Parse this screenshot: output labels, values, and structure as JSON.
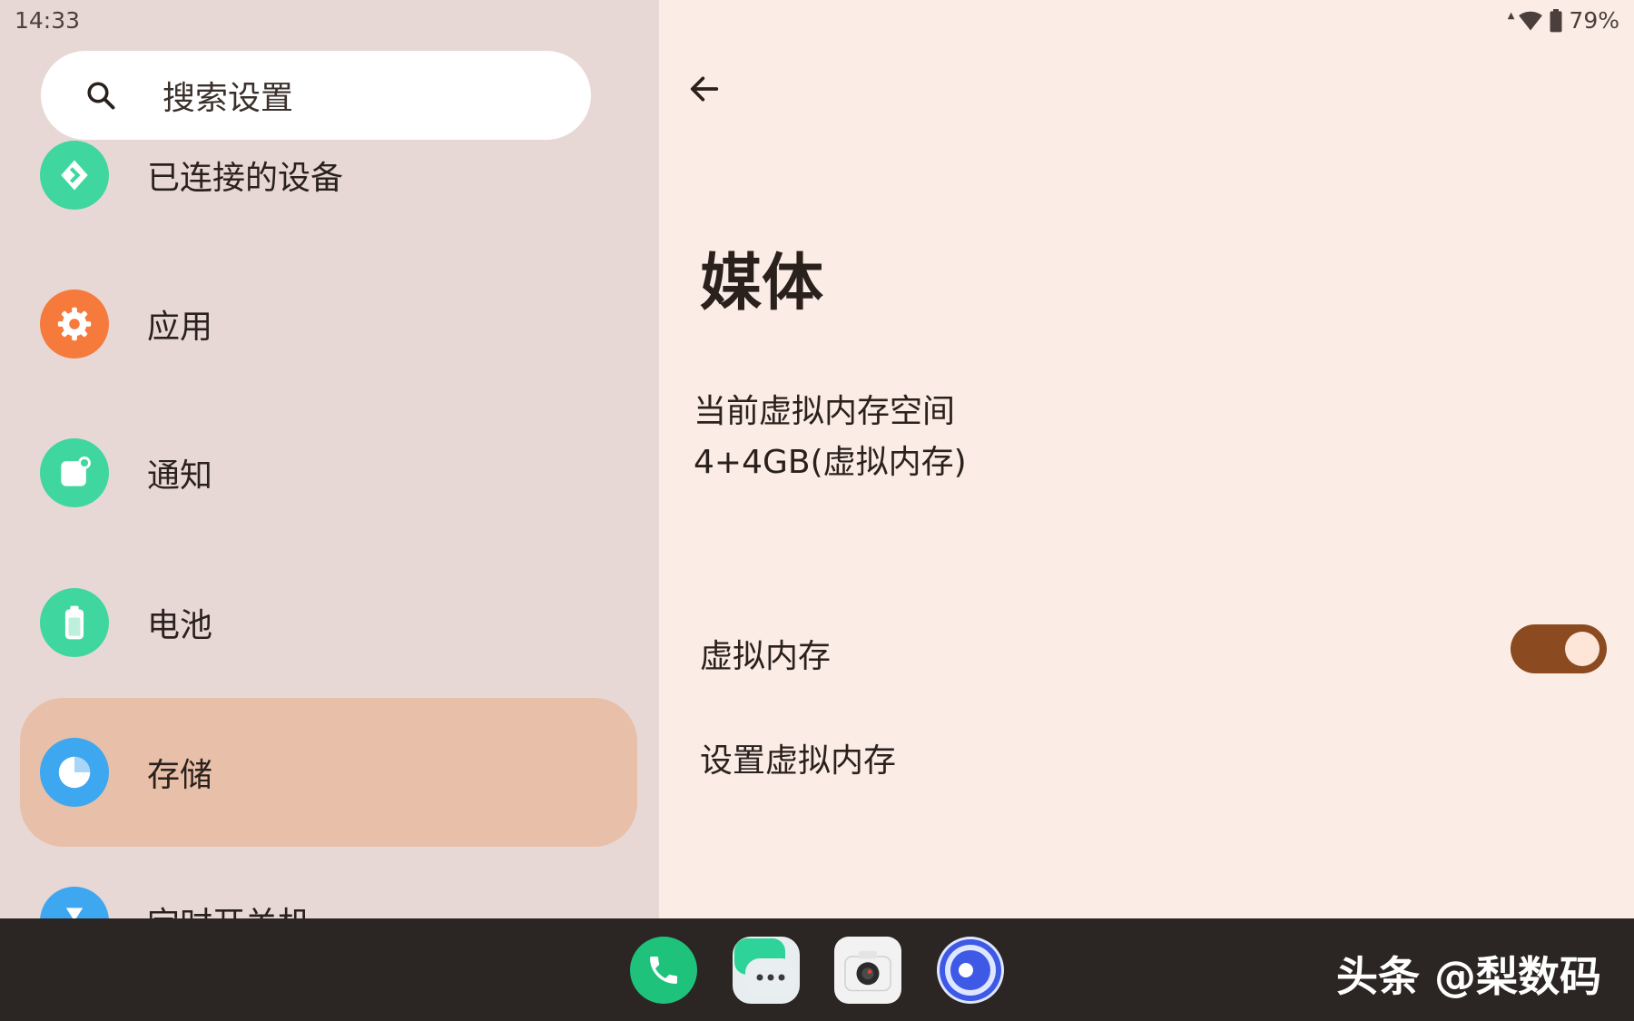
{
  "status_bar": {
    "time": "14:33",
    "battery": "79%"
  },
  "sidebar": {
    "search_placeholder": "搜索设置",
    "items": [
      {
        "label": "已连接的设备",
        "icon": "connected-devices-icon",
        "color": "#3fd6a0",
        "active": false
      },
      {
        "label": "应用",
        "icon": "apps-gear-icon",
        "color": "#f57a3c",
        "active": false
      },
      {
        "label": "通知",
        "icon": "notification-icon",
        "color": "#3fd6a0",
        "active": false
      },
      {
        "label": "电池",
        "icon": "battery-icon",
        "color": "#3fd6a0",
        "active": false
      },
      {
        "label": "存储",
        "icon": "storage-pie-icon",
        "color": "#3da7ef",
        "active": true
      },
      {
        "label": "定时开关机",
        "icon": "timer-icon",
        "color": "#3da7ef",
        "active": false
      }
    ]
  },
  "detail": {
    "title": "媒体",
    "vm_info_label": "当前虚拟内存空间",
    "vm_info_value": "4+4GB(虚拟内存)",
    "vm_toggle_label": "虚拟内存",
    "vm_toggle_on": true,
    "vm_settings_label": "设置虚拟内存"
  },
  "dock": {
    "apps": [
      "phone-app-icon",
      "messages-app-icon",
      "camera-app-icon",
      "browser-app-icon"
    ],
    "watermark": "头条 @梨数码"
  },
  "colors": {
    "accent_toggle": "#8b4a1f",
    "active_item_bg": "#e8bfa8",
    "sidebar_bg": "#e8d8d5",
    "detail_bg": "#fbece6"
  }
}
